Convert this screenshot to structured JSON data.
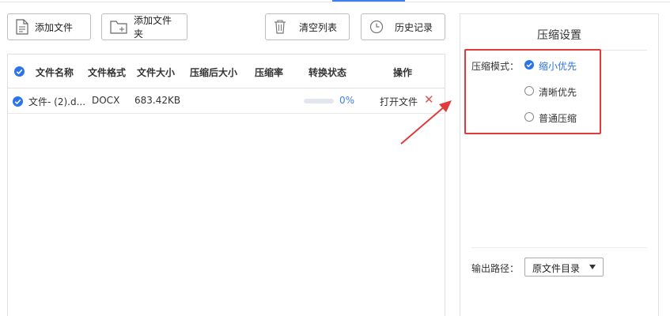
{
  "toolbar": {
    "add_file_label": "添加文件",
    "add_folder_label": "添加文件夹",
    "clear_list_label": "清空列表",
    "history_label": "历史记录"
  },
  "table": {
    "headers": [
      "文件名称",
      "文件格式",
      "文件大小",
      "压缩后大小",
      "压缩率",
      "转换状态",
      "操作"
    ],
    "rows": [
      {
        "name": "文件- (2).d...",
        "format": "DOCX",
        "size": "683.42KB",
        "compressed_size": "",
        "ratio": "",
        "progress_text": "0%",
        "progress": 0,
        "action_label": "打开文件"
      }
    ]
  },
  "settings": {
    "title": "压缩设置",
    "mode_label": "压缩模式：",
    "modes": [
      "缩小优先",
      "清晰优先",
      "普通压缩"
    ],
    "selected_mode": "缩小优先",
    "output_label": "输出路径：",
    "output_value": "原文件目录"
  },
  "colors": {
    "accent": "#2b74e8",
    "annotation": "#e03a3a",
    "delete": "#e15252"
  }
}
